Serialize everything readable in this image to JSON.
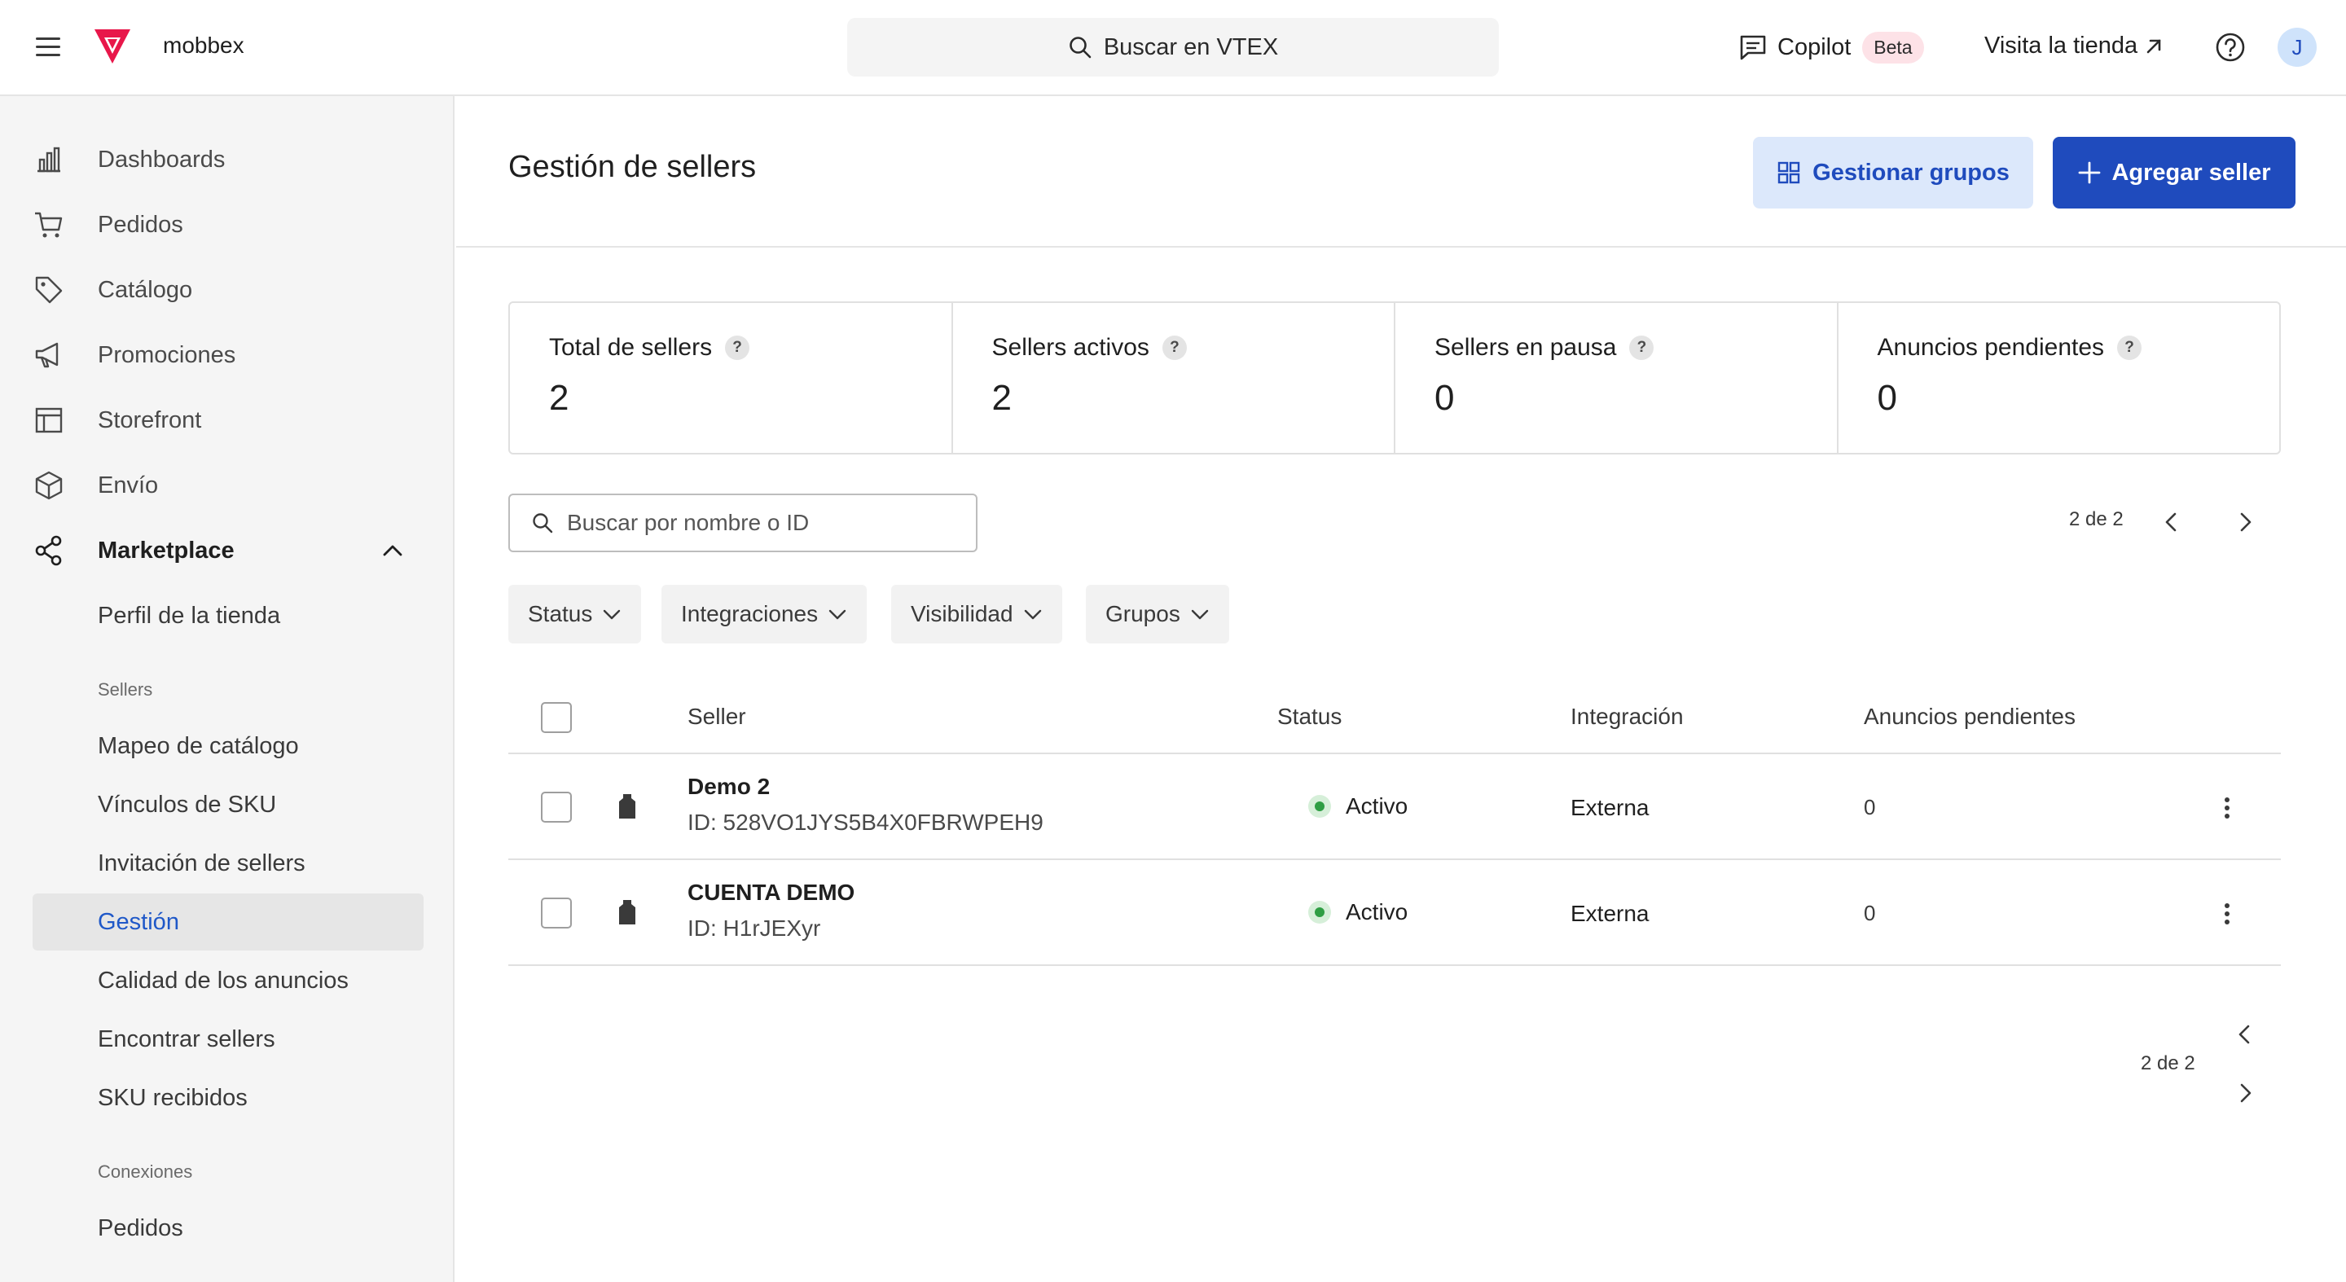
{
  "header": {
    "store_name": "mobbex",
    "search_placeholder": "Buscar en VTEX",
    "copilot_label": "Copilot",
    "copilot_badge": "Beta",
    "visit_store": "Visita la tienda",
    "avatar_initial": "J"
  },
  "sidebar": {
    "items": [
      {
        "label": "Dashboards",
        "icon": "bar-chart-icon"
      },
      {
        "label": "Pedidos",
        "icon": "cart-icon"
      },
      {
        "label": "Catálogo",
        "icon": "tag-icon"
      },
      {
        "label": "Promociones",
        "icon": "megaphone-icon"
      },
      {
        "label": "Storefront",
        "icon": "layout-icon"
      },
      {
        "label": "Envío",
        "icon": "box-icon"
      },
      {
        "label": "Marketplace",
        "icon": "share-icon"
      }
    ],
    "marketplace_sub": {
      "store_profile": "Perfil de la tienda",
      "section_sellers": "Sellers",
      "sellers_items": [
        "Mapeo de catálogo",
        "Vínculos de SKU",
        "Invitación de sellers",
        "Gestión",
        "Calidad de los anuncios",
        "Encontrar sellers",
        "SKU recibidos"
      ],
      "active_item": "Gestión",
      "section_connections": "Conexiones",
      "connections_items": [
        "Pedidos"
      ]
    }
  },
  "page": {
    "title": "Gestión de sellers",
    "manage_groups_label": "Gestionar grupos",
    "add_seller_label": "Agregar seller"
  },
  "stats": [
    {
      "title": "Total de sellers",
      "value": "2"
    },
    {
      "title": "Sellers activos",
      "value": "2"
    },
    {
      "title": "Sellers en pausa",
      "value": "0"
    },
    {
      "title": "Anuncios pendientes",
      "value": "0"
    }
  ],
  "search": {
    "placeholder": "Buscar por nombre o ID"
  },
  "pagination": {
    "label": "2 de 2"
  },
  "filters": [
    "Status",
    "Integraciones",
    "Visibilidad",
    "Grupos"
  ],
  "table": {
    "columns": [
      "Seller",
      "Status",
      "Integración",
      "Anuncios pendientes"
    ],
    "rows": [
      {
        "name": "Demo 2",
        "id": "ID: 528VO1JYS5B4X0FBRWPEH9",
        "status": "Activo",
        "integration": "Externa",
        "pending": "0"
      },
      {
        "name": "CUENTA DEMO",
        "id": "ID: H1rJEXyr",
        "status": "Activo",
        "integration": "Externa",
        "pending": "0"
      }
    ]
  },
  "colors": {
    "primary": "#1f4bbd",
    "primary_light": "#dce8fb",
    "active_status": "#2f9e44",
    "brand_logo": "#e8174a"
  }
}
